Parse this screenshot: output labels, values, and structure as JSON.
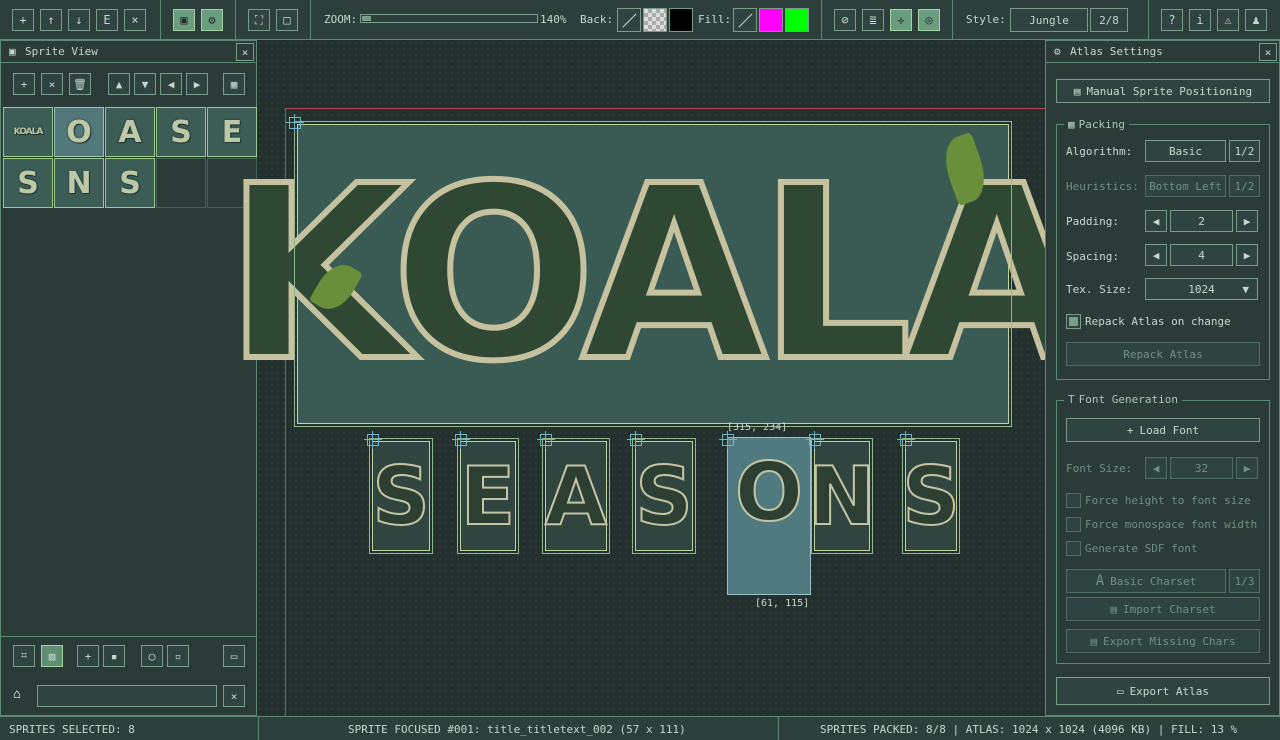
{
  "toolbar": {
    "zoom_label": "ZOOM:",
    "zoom_value": "140%",
    "zoom_fraction": 0.05,
    "back_label": "Back:",
    "fill_label": "Fill:",
    "style_label": "Style:",
    "style_value": "Jungle",
    "style_counter": "2/8",
    "colors": {
      "back_black": "#000000",
      "fill_magenta": "#ff00ff",
      "fill_green": "#00ff00"
    }
  },
  "sprite_view": {
    "title": "Sprite View",
    "tiles": [
      {
        "glyph": "KOALA",
        "selected": false
      },
      {
        "glyph": "O",
        "selected": true
      },
      {
        "glyph": "A",
        "selected": false
      },
      {
        "glyph": "S",
        "selected": false
      },
      {
        "glyph": "E",
        "selected": false
      },
      {
        "glyph": "S",
        "selected": false
      },
      {
        "glyph": "N",
        "selected": false
      },
      {
        "glyph": "S",
        "selected": false
      }
    ],
    "filter_placeholder": ""
  },
  "canvas": {
    "title_text": "KOALA",
    "glyphs": [
      "S",
      "E",
      "A",
      "S",
      "O",
      "N",
      "S"
    ],
    "focus_top_coord": "[315, 234]",
    "focus_size_coord": "[61, 115]"
  },
  "atlas_settings": {
    "title": "Atlas Settings",
    "manual_positioning": "Manual Sprite Positioning",
    "packing": {
      "label": "Packing",
      "algorithm_label": "Algorithm:",
      "algorithm_value": "Basic",
      "algorithm_counter": "1/2",
      "heuristics_label": "Heuristics:",
      "heuristics_value": "Bottom Left",
      "heuristics_counter": "1/2",
      "padding_label": "Padding:",
      "padding_value": "2",
      "spacing_label": "Spacing:",
      "spacing_value": "4",
      "tex_size_label": "Tex. Size:",
      "tex_size_value": "1024",
      "repack_on_change": "Repack Atlas on change",
      "repack_button": "Repack Atlas"
    },
    "font": {
      "label": "Font Generation",
      "load_font": "Load Font",
      "font_size_label": "Font Size:",
      "font_size_value": "32",
      "force_height": "Force height to font size",
      "force_monospace": "Force monospace font width",
      "generate_sdf": "Generate SDF font",
      "basic_charset": "Basic Charset",
      "charset_counter": "1/3",
      "import_charset": "Import Charset",
      "export_missing": "Export Missing Chars"
    },
    "export_atlas": "Export Atlas"
  },
  "status": {
    "selected": "SPRITES SELECTED: 8",
    "focused": "SPRITE FOCUSED #001: title_titletext_002 (57 x 111)",
    "packed": "SPRITES PACKED: 8/8  |  ATLAS: 1024 x 1024 (4096 KB)  |  FILL: 13 %"
  }
}
